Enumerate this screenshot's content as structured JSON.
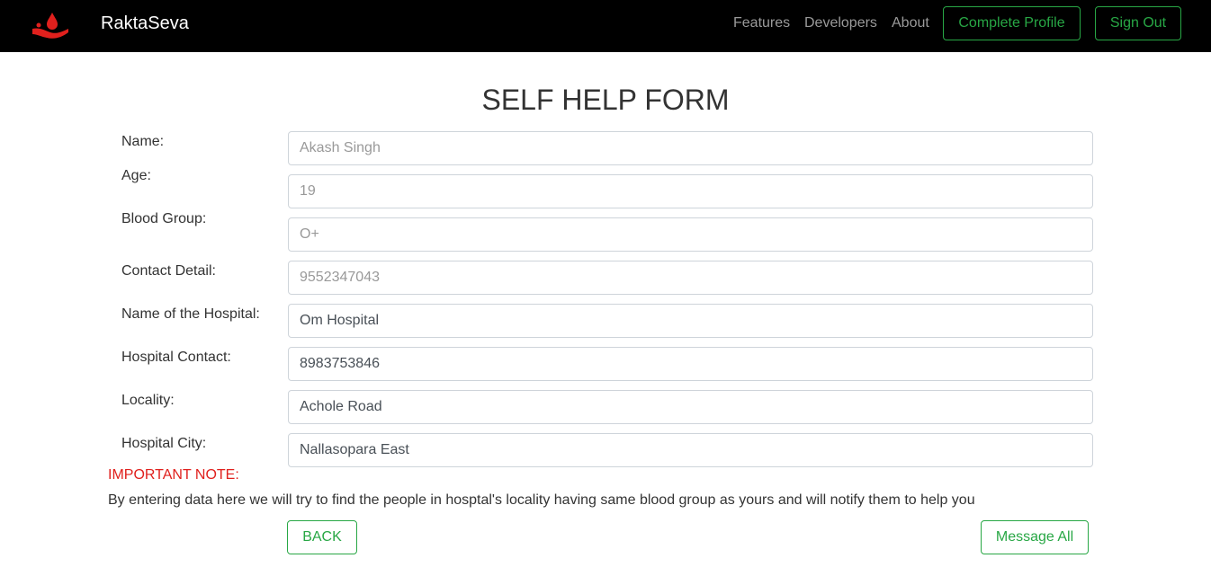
{
  "nav": {
    "brand": "RaktaSeva",
    "links": [
      "Features",
      "Developers",
      "About"
    ],
    "complete_profile": "Complete Profile",
    "sign_out": "Sign Out"
  },
  "form": {
    "title": "SELF HELP FORM",
    "fields": [
      {
        "label": "Name:",
        "value": "Akash Singh"
      },
      {
        "label": "Age:",
        "value": "19"
      },
      {
        "label": "Blood Group:",
        "value": "O+"
      },
      {
        "label": "Contact Detail:",
        "value": "9552347043"
      },
      {
        "label": "Name of the Hospital:",
        "value": "Om Hospital"
      },
      {
        "label": "Hospital Contact:",
        "value": "8983753846"
      },
      {
        "label": "Locality:",
        "value": "Achole Road"
      },
      {
        "label": "Hospital City:",
        "value": "Nallasopara East"
      }
    ],
    "note_heading": "IMPORTANT NOTE:",
    "note_text": "By entering data here we will try to find the people in hosptal's locality having same blood group as yours and will notify them to help you",
    "back": "BACK",
    "message_all": "Message All"
  },
  "colors": {
    "accent": "#28a745",
    "note": "#e0201d",
    "brand_icon": "#e0201d"
  }
}
